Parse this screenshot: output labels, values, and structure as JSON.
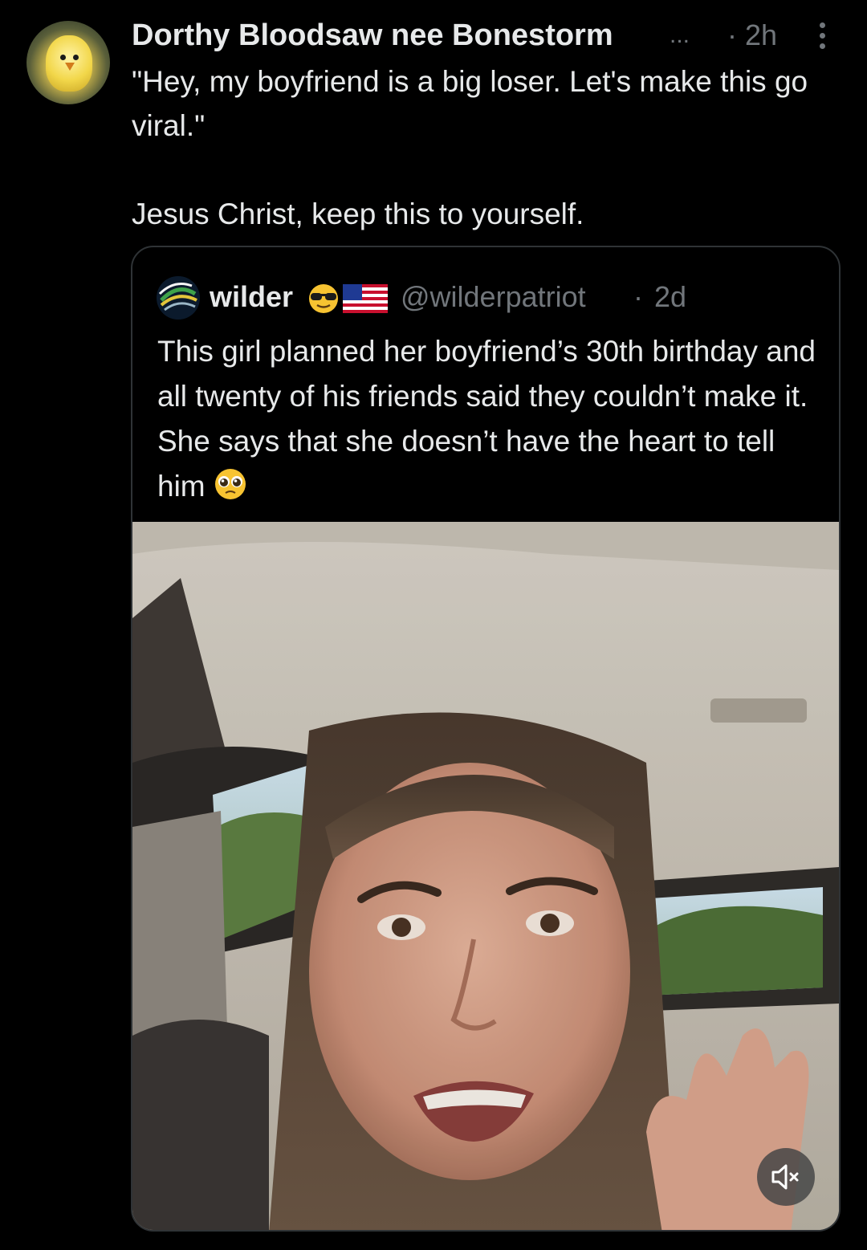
{
  "post": {
    "author": {
      "display_name": "Dorthy Bloodsaw nee Bonestorm",
      "name_truncation": "...",
      "avatar_icon": "chick-avatar"
    },
    "timestamp": "· 2h",
    "more_icon": "more-vertical-icon",
    "text": "\"Hey, my boyfriend is a big loser. Let's make this go viral.\"\n\nJesus Christ, keep this to yourself."
  },
  "quoted_post": {
    "author": {
      "display_name": "wilder",
      "emojis": [
        "smiling-face-with-sunglasses",
        "flag-united-states"
      ],
      "handle": "@wilderpatriot"
    },
    "separator": "·",
    "timestamp": "2d",
    "text": "This girl planned her boyfriend’s 30th birthday and all twenty of his friends said they couldn’t make it. She says that she doesn’t have the heart to tell him",
    "trailing_emoji": "pleading-face",
    "media": {
      "type": "video",
      "mute_icon": "speaker-muted-icon"
    }
  },
  "colors": {
    "background": "#000000",
    "primary_text": "#e7e9ea",
    "secondary_text": "#71767b",
    "card_border": "#2f3336"
  }
}
